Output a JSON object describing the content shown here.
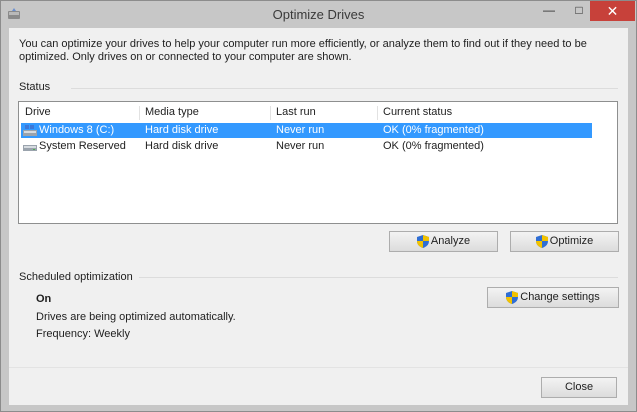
{
  "window": {
    "title": "Optimize Drives",
    "minimize_glyph": "—",
    "maximize_glyph": "□",
    "close_glyph": "✕"
  },
  "description": "You can optimize your drives to help your computer run more efficiently, or analyze them to find out if they need to be optimized. Only drives on or connected to your computer are shown.",
  "status": {
    "label": "Status",
    "columns": [
      "Drive",
      "Media type",
      "Last run",
      "Current status"
    ],
    "drives": [
      {
        "name": "Windows 8 (C:)",
        "media_type": "Hard disk drive",
        "last_run": "Never run",
        "current_status": "OK (0% fragmented)",
        "icon": "windows-drive-icon",
        "selected": true
      },
      {
        "name": "System Reserved",
        "media_type": "Hard disk drive",
        "last_run": "Never run",
        "current_status": "OK (0% fragmented)",
        "icon": "drive-icon",
        "selected": false
      }
    ],
    "analyze_label": "Analyze",
    "optimize_label": "Optimize"
  },
  "scheduled": {
    "label": "Scheduled optimization",
    "state": "On",
    "info": "Drives are being optimized automatically.",
    "frequency": "Frequency: Weekly",
    "change_label": "Change settings"
  },
  "footer": {
    "close_label": "Close"
  },
  "colors": {
    "selection": "#3399ff",
    "close_button": "#c7413a"
  }
}
